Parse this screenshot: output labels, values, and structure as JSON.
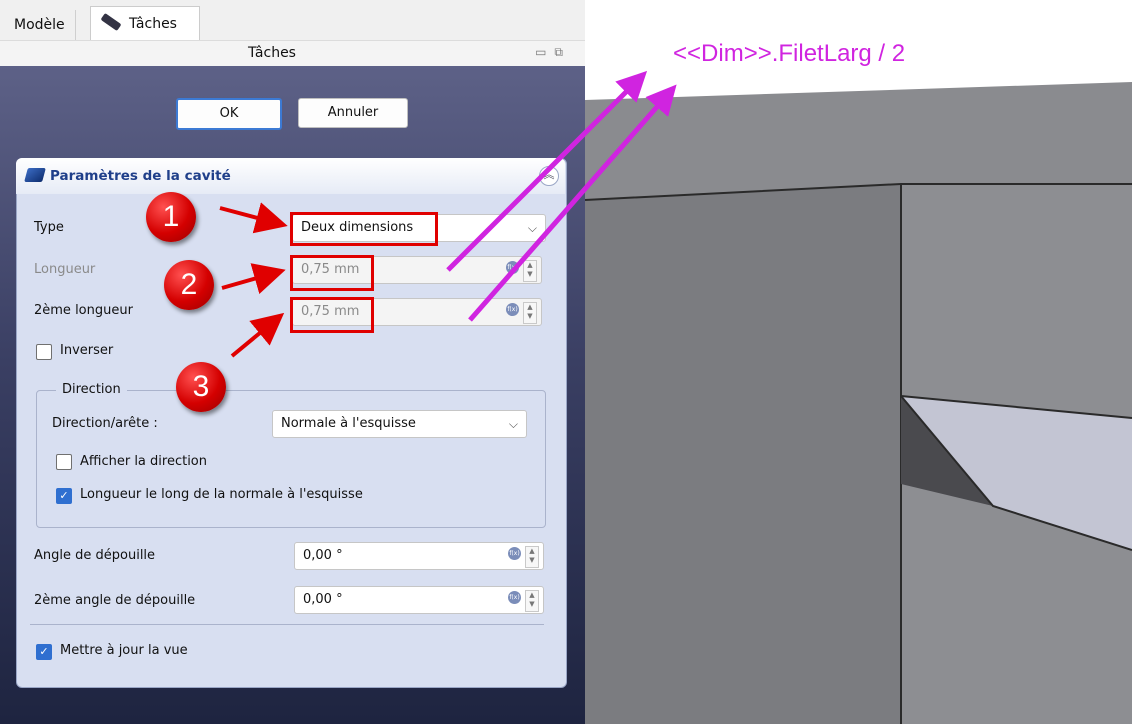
{
  "tabs": [
    {
      "label": "Modèle"
    },
    {
      "label": "Tâches"
    }
  ],
  "dock": {
    "title": "Tâches"
  },
  "buttons": {
    "ok": "OK",
    "cancel": "Annuler"
  },
  "section": {
    "title": "Paramètres de la cavité"
  },
  "type": {
    "label": "Type",
    "value": "Deux dimensions"
  },
  "length": {
    "label": "Longueur",
    "value": "0,75 mm"
  },
  "length2": {
    "label": "2ème longueur",
    "value": "0,75 mm"
  },
  "reverse": {
    "label": "Inverser",
    "checked": false
  },
  "direction": {
    "group_label": "Direction",
    "edge_label": "Direction/arête :",
    "edge_value": "Normale à l'esquisse",
    "show_label": "Afficher la direction",
    "show_checked": false,
    "along_normal_label": "Longueur le long de la normale à l'esquisse",
    "along_normal_checked": true
  },
  "taper": {
    "label": "Angle de dépouille",
    "value": "0,00 °"
  },
  "taper2": {
    "label": "2ème angle de dépouille",
    "value": "0,00 °"
  },
  "update_view": {
    "label": "Mettre à jour la vue",
    "checked": true
  },
  "annotations": {
    "n1": "1",
    "n2": "2",
    "n3": "3",
    "formula": "<<Dim>>.FiletLarg / 2"
  },
  "colors": {
    "annotation_red": "#e00000",
    "formula_magenta": "#d024e0",
    "checkbox_blue": "#2f6fd0",
    "viewport_gray": "#86878b"
  }
}
